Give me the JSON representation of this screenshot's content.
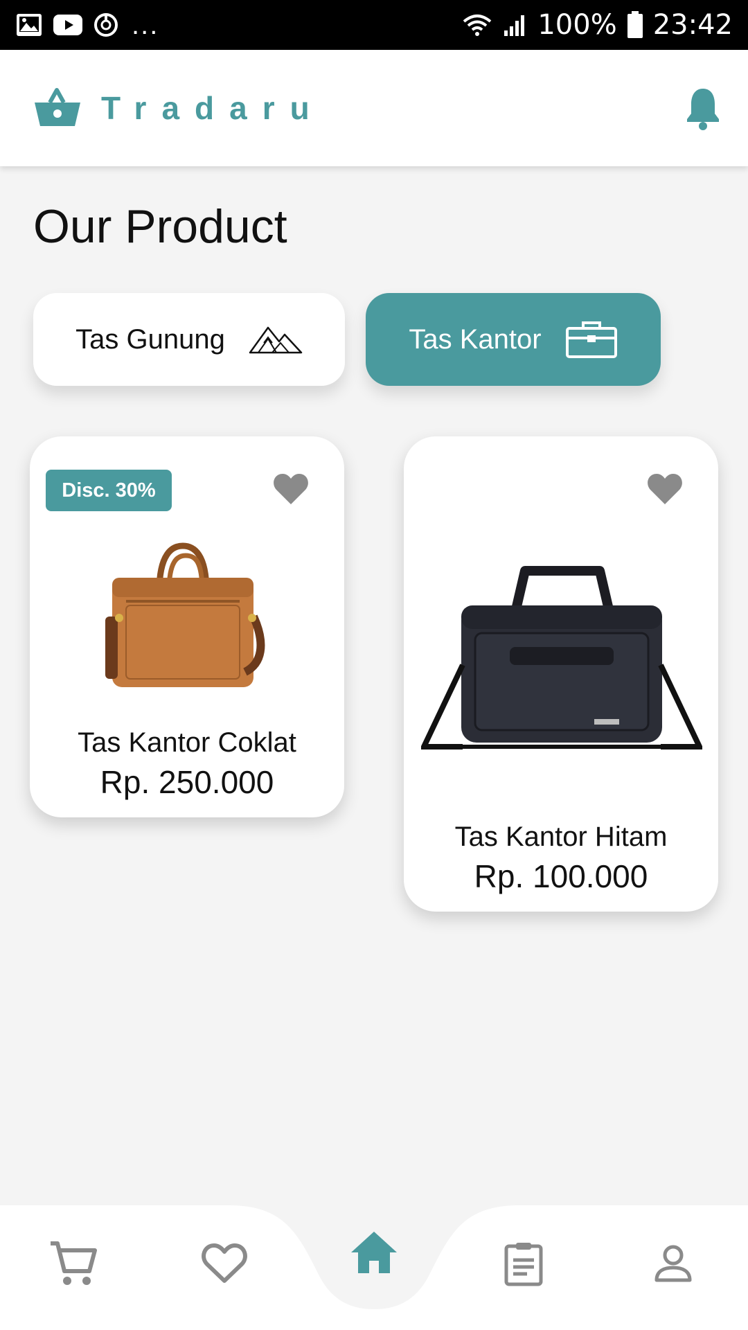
{
  "status_bar": {
    "dots": "...",
    "battery": "100%",
    "time": "23:42"
  },
  "header": {
    "brand": "Tradaru",
    "icons": [
      "basket-icon",
      "bell-icon"
    ]
  },
  "page": {
    "title": "Our Product"
  },
  "categories": [
    {
      "label": "Tas Gunung",
      "icon": "mountain-icon",
      "selected": false
    },
    {
      "label": "Tas Kantor",
      "icon": "briefcase-icon",
      "selected": true
    }
  ],
  "products": [
    {
      "name": "Tas Kantor Coklat",
      "price": "Rp. 250.000",
      "badge": "Disc. 30%"
    },
    {
      "name": "Tas Kantor Hitam",
      "price": "Rp. 100.000"
    }
  ],
  "nav": {
    "items": [
      "cart-icon",
      "heart-icon",
      "home-icon",
      "clipboard-icon",
      "user-icon"
    ],
    "active": "home-icon"
  },
  "colors": {
    "accent": "#4a9a9e",
    "background": "#f4f4f4",
    "icon_gray": "#8a8a8a"
  }
}
